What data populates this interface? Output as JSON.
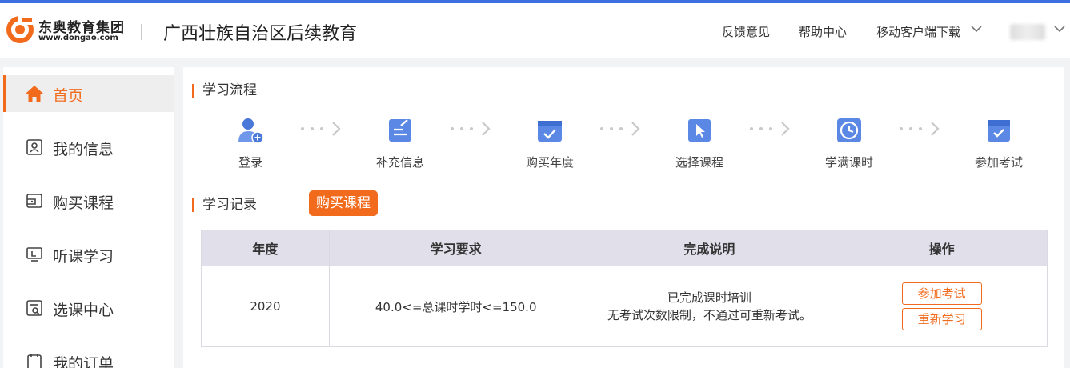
{
  "brand": {
    "logo_cn": "东奥教育集团",
    "logo_url": "www.dongao.com",
    "accent": "#f26b1d",
    "top_line": "#3d6fe0"
  },
  "header": {
    "site_title": "广西壮族自治区后续教育",
    "links": {
      "feedback": "反馈意见",
      "help": "帮助中心",
      "mobile": "移动客户端下载"
    }
  },
  "sidebar": {
    "items": [
      {
        "label": "首页",
        "icon": "home-icon",
        "active": true
      },
      {
        "label": "我的信息",
        "icon": "id-card-icon"
      },
      {
        "label": "购买课程",
        "icon": "wallet-icon"
      },
      {
        "label": "听课学习",
        "icon": "monitor-icon"
      },
      {
        "label": "选课中心",
        "icon": "course-select-icon"
      },
      {
        "label": "我的订单",
        "icon": "clipboard-icon"
      }
    ]
  },
  "flow": {
    "title": "学习流程",
    "steps": [
      {
        "label": "登录",
        "icon": "user-add-icon"
      },
      {
        "label": "补充信息",
        "icon": "edit-doc-icon"
      },
      {
        "label": "购买年度",
        "icon": "calendar-check-icon"
      },
      {
        "label": "选择课程",
        "icon": "cursor-icon"
      },
      {
        "label": "学满课时",
        "icon": "clock-icon"
      },
      {
        "label": "参加考试",
        "icon": "exam-check-icon"
      }
    ]
  },
  "records": {
    "title": "学习记录",
    "buy_button": "购买课程",
    "headers": {
      "year": "年度",
      "requirement": "学习要求",
      "note": "完成说明",
      "action": "操作"
    },
    "rows": [
      {
        "year": "2020",
        "requirement": "40.0<=总课时学时<=150.0",
        "note_line1": "已完成课时培训",
        "note_line2": "无考试次数限制，不通过可重新考试。",
        "exam_button": "参加考试",
        "relearn_button": "重新学习"
      }
    ]
  }
}
